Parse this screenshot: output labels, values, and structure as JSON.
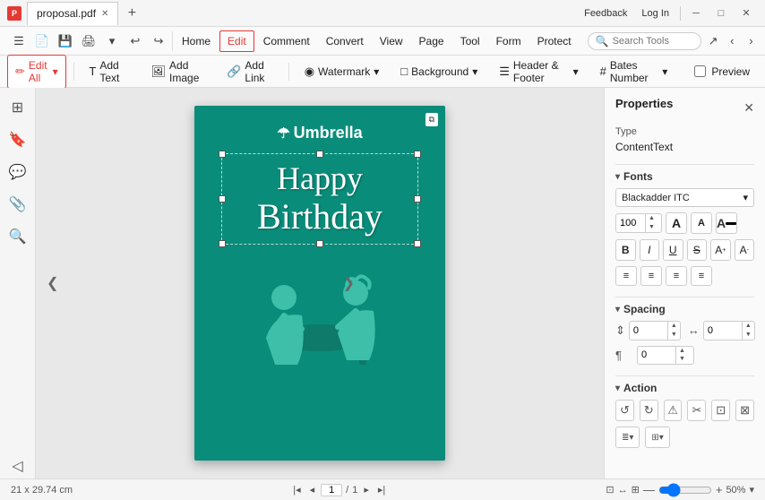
{
  "titlebar": {
    "app_icon": "P",
    "tab_name": "proposal.pdf",
    "feedback_label": "Feedback",
    "login_label": "Log In"
  },
  "menubar": {
    "items": [
      "Home",
      "Edit",
      "Comment",
      "Convert",
      "View",
      "Page",
      "Tool",
      "Form",
      "Protect"
    ],
    "active_item": "Edit",
    "search_placeholder": "Search Tools"
  },
  "toolbar": {
    "edit_all_label": "Edit All",
    "add_text_label": "Add Text",
    "add_image_label": "Add Image",
    "add_link_label": "Add Link",
    "watermark_label": "Watermark",
    "background_label": "Background",
    "header_footer_label": "Header & Footer",
    "bates_number_label": "Bates Number",
    "preview_label": "Preview"
  },
  "sidebar": {
    "icons": [
      "pages",
      "bookmark",
      "comment",
      "attachment",
      "search"
    ]
  },
  "pdf_page": {
    "logo_text": "Umbrella",
    "happy_text": "Happy",
    "birthday_text": "Birthday"
  },
  "properties_panel": {
    "title": "Properties",
    "type_label": "Type",
    "type_value": "ContentText",
    "fonts_section": "Fonts",
    "font_name": "Blackadder ITC",
    "font_size": "100",
    "spacing_section": "Spacing",
    "line_spacing_value": "0",
    "char_spacing_value": "0",
    "para_spacing_value": "0",
    "action_section": "Action"
  },
  "statusbar": {
    "dimensions": "21 x 29.74 cm",
    "page_input": "1",
    "page_total": "1",
    "zoom_value": "50%"
  }
}
